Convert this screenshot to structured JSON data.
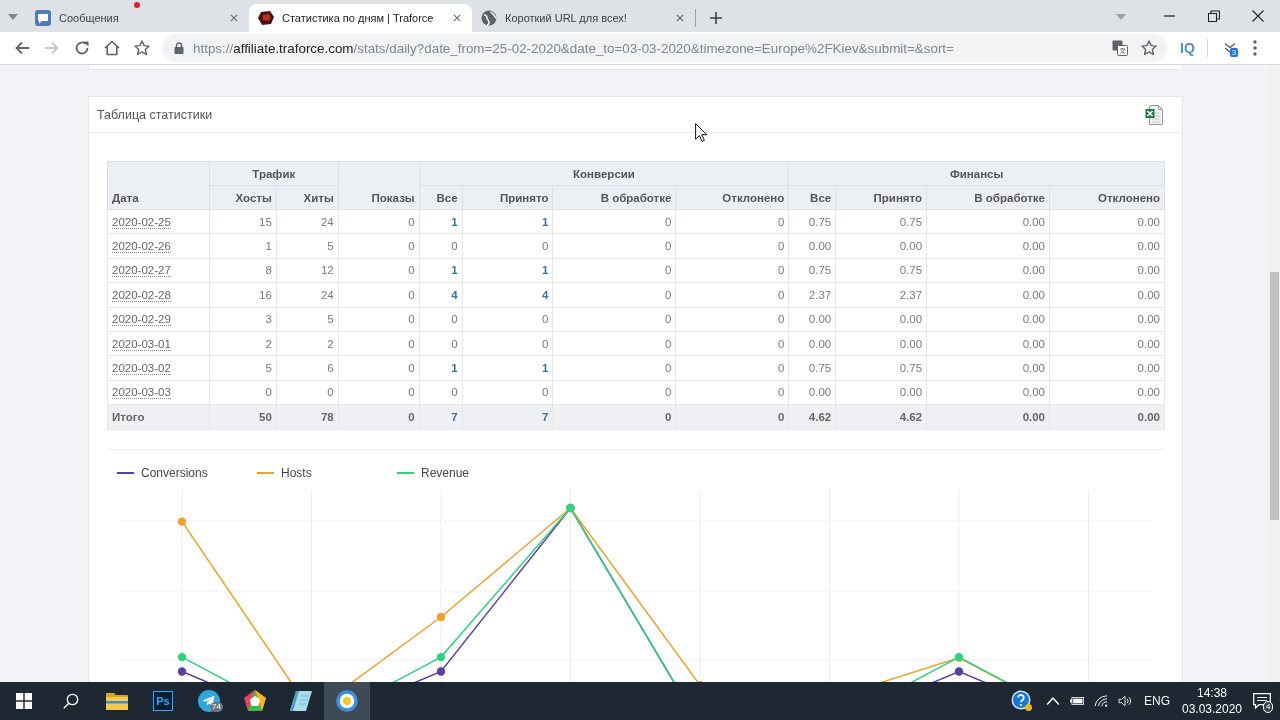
{
  "browser": {
    "tabs": [
      {
        "title": "Сообщения",
        "kind": "chat",
        "notification": true,
        "selected": false
      },
      {
        "title": "Статистика по дням | Traforce",
        "kind": "logo",
        "notification": false,
        "selected": true
      },
      {
        "title": "Короткий URL для всех!",
        "kind": "globe",
        "notification": false,
        "selected": false
      }
    ],
    "toolbar": {
      "forward_disabled": true,
      "url": {
        "scheme": "https://",
        "host": "affiliate.traforce.com",
        "rest": "/stats/daily?date_from=25-02-2020&date_to=03-03-2020&timezone=Europe%2FKiev&submit=&sort="
      },
      "extension_label": "IQ",
      "extension_badge": "3"
    }
  },
  "stats_card": {
    "title": "Таблица статистики",
    "columns": [
      {
        "label": "Дата",
        "kind": "date"
      },
      {
        "label": "Трафик",
        "colspan": 2,
        "children": [
          {
            "label": "Хосты",
            "kind": "number"
          },
          {
            "label": "Хиты",
            "kind": "number"
          }
        ]
      },
      {
        "label": "Показы",
        "kind": "number"
      },
      {
        "label": "Конверсии",
        "colspan": 4,
        "children": [
          {
            "label": "Все",
            "kind": "link"
          },
          {
            "label": "Принято",
            "kind": "link"
          },
          {
            "label": "В обработке",
            "kind": "number"
          },
          {
            "label": "Отклонено",
            "kind": "number"
          }
        ]
      },
      {
        "label": "Финансы",
        "colspan": 4,
        "children": [
          {
            "label": "Все",
            "kind": "number"
          },
          {
            "label": "Принято",
            "kind": "number"
          },
          {
            "label": "В обработке",
            "kind": "number"
          },
          {
            "label": "Отклонено",
            "kind": "number"
          }
        ]
      }
    ],
    "rows": [
      {
        "kind": "day",
        "linked": true,
        "cells": [
          "2020-02-25",
          "15",
          "24",
          "0",
          "1",
          "1",
          "0",
          "0",
          "0.75",
          "0.75",
          "0.00",
          "0.00"
        ]
      },
      {
        "kind": "day",
        "linked": false,
        "cells": [
          "2020-02-26",
          "1",
          "5",
          "0",
          "0",
          "0",
          "0",
          "0",
          "0.00",
          "0.00",
          "0.00",
          "0.00"
        ]
      },
      {
        "kind": "day",
        "linked": true,
        "cells": [
          "2020-02-27",
          "8",
          "12",
          "0",
          "1",
          "1",
          "0",
          "0",
          "0.75",
          "0.75",
          "0.00",
          "0.00"
        ]
      },
      {
        "kind": "day",
        "linked": true,
        "cells": [
          "2020-02-28",
          "16",
          "24",
          "0",
          "4",
          "4",
          "0",
          "0",
          "2.37",
          "2.37",
          "0.00",
          "0.00"
        ]
      },
      {
        "kind": "day",
        "linked": false,
        "cells": [
          "2020-02-29",
          "3",
          "5",
          "0",
          "0",
          "0",
          "0",
          "0",
          "0.00",
          "0.00",
          "0.00",
          "0.00"
        ]
      },
      {
        "kind": "day",
        "linked": false,
        "cells": [
          "2020-03-01",
          "2",
          "2",
          "0",
          "0",
          "0",
          "0",
          "0",
          "0.00",
          "0.00",
          "0.00",
          "0.00"
        ]
      },
      {
        "kind": "day",
        "linked": true,
        "cells": [
          "2020-03-02",
          "5",
          "6",
          "0",
          "1",
          "1",
          "0",
          "0",
          "0.75",
          "0.75",
          "0.00",
          "0.00"
        ]
      },
      {
        "kind": "day",
        "linked": false,
        "cells": [
          "2020-03-03",
          "0",
          "0",
          "0",
          "0",
          "0",
          "0",
          "0",
          "0.00",
          "0.00",
          "0.00",
          "0.00"
        ]
      },
      {
        "kind": "total",
        "linked": true,
        "cells": [
          "Итого",
          "50",
          "78",
          "0",
          "7",
          "7",
          "0",
          "0",
          "4.62",
          "4.62",
          "0.00",
          "0.00"
        ]
      }
    ],
    "legend": [
      {
        "label": "Conversions",
        "color": "#5b3f9e"
      },
      {
        "label": "Hosts",
        "color": "#f0a12c"
      },
      {
        "label": "Revenue",
        "color": "#2fd37f"
      }
    ]
  },
  "taskbar": {
    "apps": [
      {
        "kind": "folder",
        "selected": false
      },
      {
        "kind": "ps",
        "text": "Ps",
        "selected": false
      },
      {
        "kind": "plane",
        "badge": "74",
        "selected": false
      },
      {
        "kind": "pentagon",
        "selected": false
      },
      {
        "kind": "notepad",
        "selected": false
      },
      {
        "kind": "ring",
        "selected": true
      }
    ],
    "language": "ENG",
    "time": "14:38",
    "date": "03.03.2020",
    "notifications": "4"
  }
}
